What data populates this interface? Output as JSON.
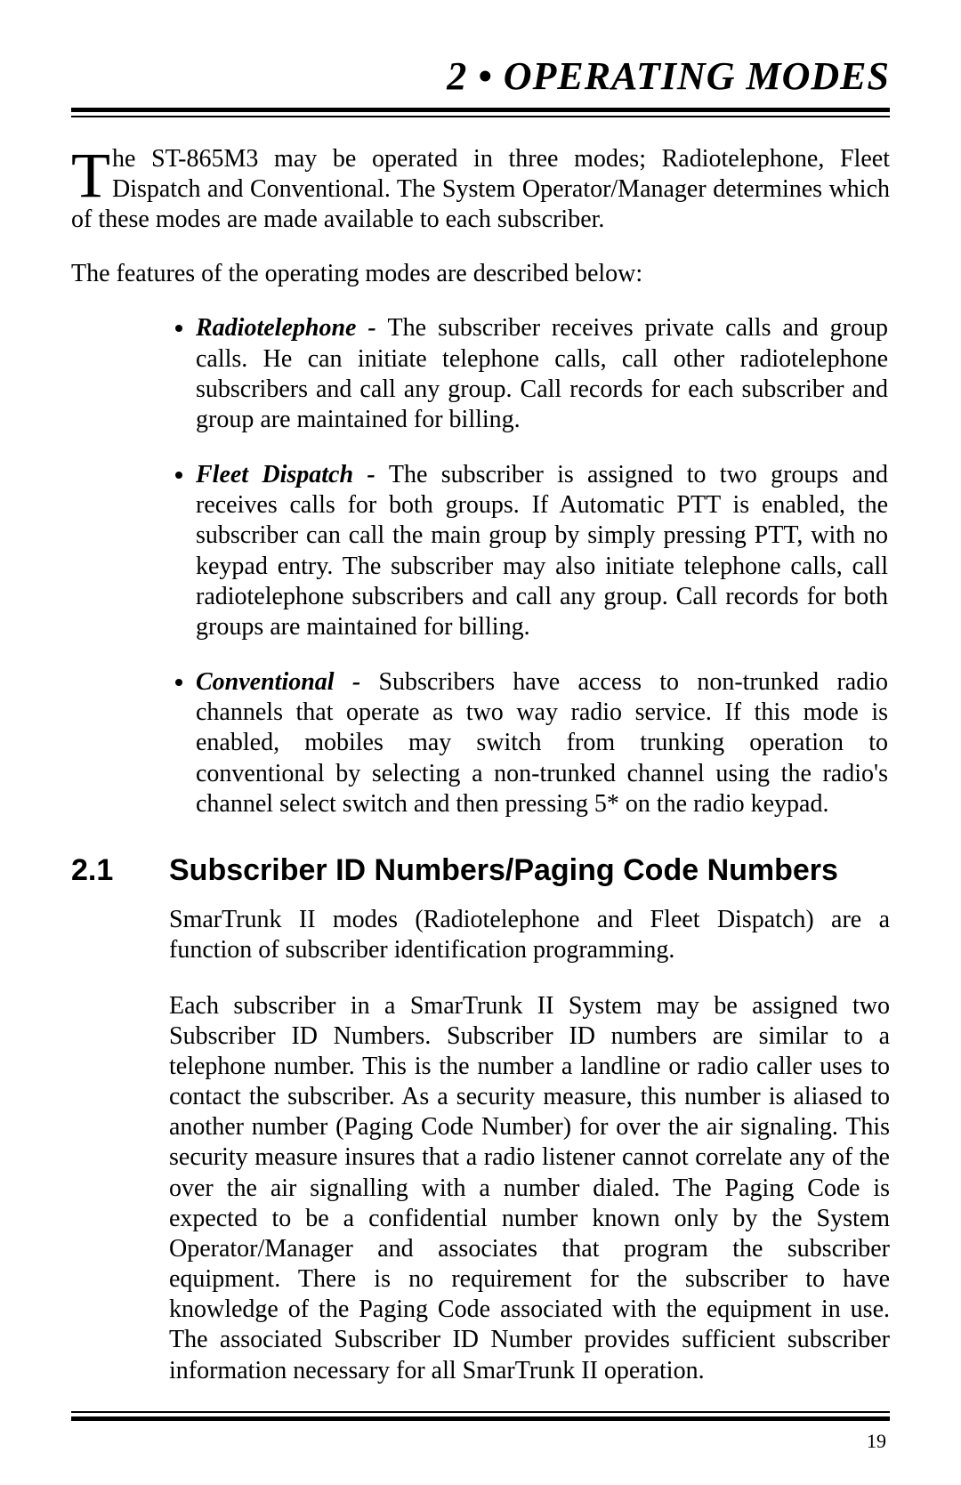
{
  "chapter": {
    "number": "2",
    "bullet": "•",
    "title": "OPERATING MODES"
  },
  "intro": {
    "dropcap": "T",
    "text": "he ST-865M3 may be operated in three modes; Radiotelephone, Fleet Dispatch and Conventional.  The System Operator/Manager determines which of these modes are made available to each subscriber."
  },
  "features_intro": "The features of the operating modes are described below:",
  "modes": [
    {
      "name": "Radiotelephone - ",
      "desc": "The subscriber receives private calls and group calls.  He can initiate telephone calls, call other radiotelephone subscribers and call any group.  Call records for each subscriber and group are maintained for billing."
    },
    {
      "name": "Fleet Dispatch - ",
      "desc": "The subscriber is assigned to two groups and receives calls for both groups.  If Automatic PTT is enabled, the subscriber can call the main group by simply pressing PTT, with no keypad entry.  The subscriber may also initiate telephone calls, call radiotelephone subscribers and call any group.  Call records for both groups are maintained for billing."
    },
    {
      "name": "Conventional - ",
      "desc": "Subscribers have access to non-trunked radio channels that operate as two way radio service.  If this mode is enabled, mobiles may switch from trunking operation to conventional by selecting a non-trunked channel using the radio's channel select switch and then pressing 5* on the radio keypad."
    }
  ],
  "section": {
    "number": "2.1",
    "title": "Subscriber ID Numbers/Paging Code Numbers",
    "p1": "SmarTrunk II modes (Radiotelephone and Fleet Dispatch) are a function of subscriber identification programming.",
    "p2": "Each subscriber in a SmarTrunk II System may be assigned two Subscriber ID Numbers.  Subscriber ID numbers are similar to a telephone number.  This is the number a landline or radio caller uses to contact the subscriber.  As a security measure, this number is aliased to another number (Paging Code Number) for over the air signaling.  This security measure insures that a radio listener cannot correlate any of the over the air signalling with a number dialed.  The Paging Code is expected to be a confidential number known only by the System Operator/Manager and associates that program the subscriber equipment.  There is no requirement for the subscriber to have knowledge of the Paging Code associated with the equipment in use.  The associated Subscriber ID Number provides sufficient subscriber information necessary for all SmarTrunk II operation."
  },
  "page_number": "19"
}
